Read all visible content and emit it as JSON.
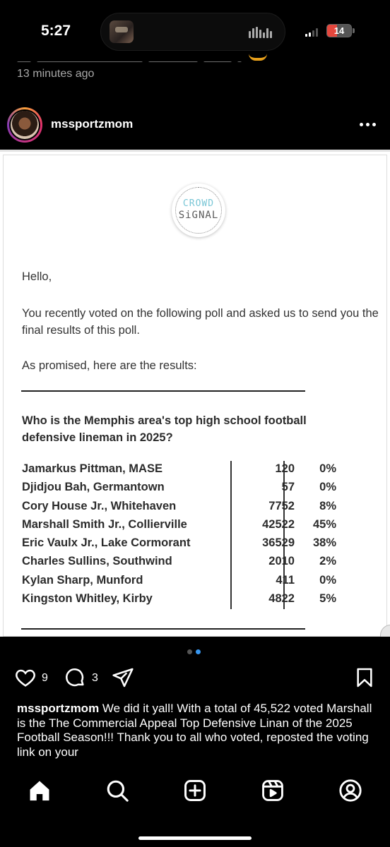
{
  "status_bar": {
    "time": "5:27",
    "battery_level": "14"
  },
  "previous_post": {
    "time_ago": "13 minutes ago"
  },
  "post": {
    "username": "mssportzmom",
    "likes": "9",
    "comments": "3",
    "carousel": {
      "total": 2,
      "active": 2
    }
  },
  "email": {
    "logo_line1": "CROWD",
    "logo_line2": "SiGNAL",
    "greeting": "Hello,",
    "intro": "You recently voted on the following poll and asked us to send you the final results of this poll.",
    "promise": "As promised, here are the results:",
    "question": "Who is the Memphis area's top high school football defensive lineman in 2025?",
    "results": [
      {
        "name": "Jamarkus Pittman, MASE",
        "votes": "120",
        "pct": "0%"
      },
      {
        "name": "Djidjou Bah, Germantown",
        "votes": "57",
        "pct": "0%"
      },
      {
        "name": "Cory House Jr., Whitehaven",
        "votes": "7752",
        "pct": "8%"
      },
      {
        "name": "Marshall Smith Jr., Collierville",
        "votes": "42522",
        "pct": "45%"
      },
      {
        "name": "Eric Vaulx Jr., Lake Cormorant",
        "votes": "36529",
        "pct": "38%"
      },
      {
        "name": "Charles Sullins, Southwind",
        "votes": "2010",
        "pct": "2%"
      },
      {
        "name": "Kylan Sharp, Munford",
        "votes": "411",
        "pct": "0%"
      },
      {
        "name": "Kingston Whitley, Kirby",
        "votes": "4822",
        "pct": "5%"
      }
    ]
  },
  "caption": {
    "username": "mssportzmom",
    "text": " We did it yall! With a total of 45,522 voted Marshall is the The Commercial Appeal Top Defensive Linan of the 2025 Football Season!!! Thank you to all who voted, reposted the voting link on your"
  },
  "nav": [
    "home-icon",
    "search-icon",
    "create-icon",
    "reels-icon",
    "profile-icon"
  ],
  "colors": {
    "background": "#000000",
    "accent": "#3897f0",
    "battery": "#e5473d"
  }
}
